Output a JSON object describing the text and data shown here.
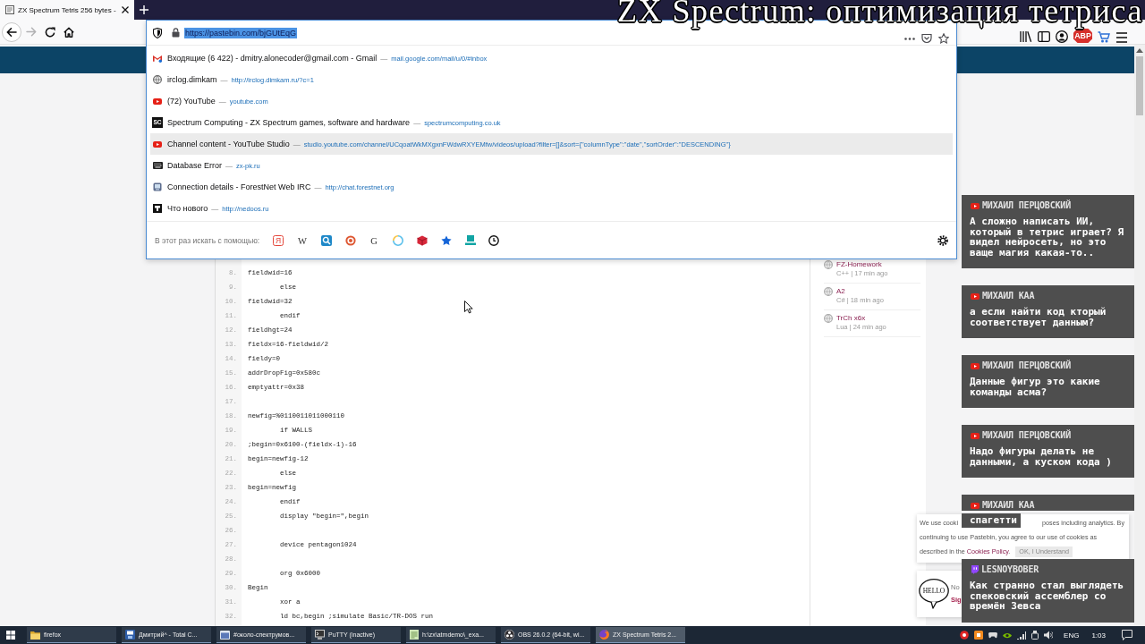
{
  "overlay_title": "ZX Spectrum: оптимизация тетриса",
  "browser": {
    "tabs": [
      {
        "title": "ZX Spectrum Tetris 256 bytes -",
        "selected": true
      }
    ],
    "nav_buttons": [
      {
        "kind": "back",
        "disabled": false
      },
      {
        "kind": "forward",
        "disabled": true
      },
      {
        "kind": "reload",
        "disabled": false
      },
      {
        "kind": "home",
        "disabled": false
      }
    ],
    "address_bar": {
      "value": "https://pastebin.com/bjGUtEqG",
      "selected": true
    },
    "suggestions": [
      {
        "kind": "mail",
        "title": "Входящие (6 422) - dmitry.alonecoder@gmail.com - Gmail",
        "separator": "—",
        "url": "mail.google.com/mail/u/0/#inbox",
        "selected": false
      },
      {
        "kind": "globe",
        "title": "irclog.dimkam",
        "separator": "—",
        "url": "http://irclog.dimkam.ru/?c=1",
        "selected": false
      },
      {
        "kind": "video",
        "title": "(72) YouTube",
        "separator": "—",
        "url": "youtube.com",
        "selected": false
      },
      {
        "kind": "letters",
        "icon_text": "SC",
        "title": "Spectrum Computing - ZX Spectrum games, software and hardware",
        "separator": "—",
        "url": "spectrumcomputing.co.uk",
        "selected": false
      },
      {
        "kind": "video",
        "title": "Channel content - YouTube Studio",
        "separator": "—",
        "url": "studio.youtube.com/channel/UCqoatWkMXgxnFWdwRXYEMfw/videos/upload?filter=[]&sort={\"columnType\":\"date\",\"sortOrder\":\"DESCENDING\"}",
        "selected": true
      },
      {
        "kind": "keyboard",
        "title": "Database Error",
        "separator": "—",
        "url": "zx-pk.ru",
        "selected": false
      },
      {
        "kind": "monitor",
        "title": "Connection details - ForestNet Web IRC",
        "separator": "—",
        "url": "http://chat.forestnet.org",
        "selected": false
      },
      {
        "kind": "tile",
        "title": "Что нового",
        "separator": "—",
        "url": "http://nedoos.ru",
        "selected": false
      }
    ],
    "search_with": {
      "label": "В этот раз искать с помощью:",
      "engines": [
        {
          "kind": "letter_tile",
          "glyph": "Я"
        },
        {
          "kind": "letter",
          "glyph": "W"
        },
        {
          "kind": "search"
        },
        {
          "kind": "round_badge"
        },
        {
          "kind": "letter",
          "glyph": "G"
        },
        {
          "kind": "ring"
        },
        {
          "kind": "cube"
        },
        {
          "kind": "star"
        },
        {
          "kind": "laptop"
        },
        {
          "kind": "clock"
        }
      ]
    },
    "toolbar": {
      "badge_text": "ABP"
    }
  },
  "page": {
    "code_lines": [
      {
        "number": "8.",
        "text": "fieldwid=16"
      },
      {
        "number": "9.",
        "text": "\telse"
      },
      {
        "number": "10.",
        "text": "fieldwid=32"
      },
      {
        "number": "11.",
        "text": "\tendif"
      },
      {
        "number": "12.",
        "text": "fieldhgt=24"
      },
      {
        "number": "13.",
        "text": "fieldx=16-fieldwid/2"
      },
      {
        "number": "14.",
        "text": "fieldy=0"
      },
      {
        "number": "15.",
        "text": "addrDropFig=0x580c"
      },
      {
        "number": "16.",
        "text": "emptyattr=0x38"
      },
      {
        "number": "17."
      },
      {
        "number": "18.",
        "text": "newfig=%0110011011000110"
      },
      {
        "number": "19.",
        "text": "\tif WALLS"
      },
      {
        "number": "20.",
        "text": ";begin=0x6100-(fieldx-1)-16"
      },
      {
        "number": "21.",
        "text": "begin=newfig-12"
      },
      {
        "number": "22.",
        "text": "\telse"
      },
      {
        "number": "23.",
        "text": "begin=newfig"
      },
      {
        "number": "24.",
        "text": "\tendif"
      },
      {
        "number": "25.",
        "text": "\tdisplay \"begin=\",begin"
      },
      {
        "number": "26."
      },
      {
        "number": "27.",
        "text": "\tdevice pentagon1024"
      },
      {
        "number": "28."
      },
      {
        "number": "29.",
        "text": "\torg 0x6000"
      },
      {
        "number": "30.",
        "text": "Begin"
      },
      {
        "number": "31.",
        "text": "\txor a"
      },
      {
        "number": "32.",
        "text": "\tld bc,begin ;simulate Basic/TR-DOS run"
      }
    ],
    "recent_pastes": [
      {
        "title": "FZ-Homework",
        "meta": "C++ | 17 min ago"
      },
      {
        "title": "A2",
        "meta": "C# | 18 min ago"
      },
      {
        "title": "TrCh x6x",
        "meta": "Lua | 24 min ago"
      }
    ],
    "cookie_notice": {
      "fragment_1": "We use cooki",
      "fragment_2": "poses including analytics. By",
      "line_2": "continuing to use Pastebin, you agree to our use of cookies as",
      "line_3_text": "described in the",
      "policy_link": "Cookies Policy",
      "line_3_end": ".",
      "accept_button": "OK, I Understand"
    },
    "signup": {
      "badge": "HELLO",
      "fragment_1": "No",
      "fragment_2": "Sig"
    }
  },
  "chat": [
    {
      "kind": "youtube",
      "author": "МИХАИЛ ПЕРЦОВСКИЙ",
      "text": "А сложно написать ИИ, который в тетрис играет? Я видел нейросеть, но это ваще магия какая-то.."
    },
    {
      "kind": "youtube",
      "author": "МИХАИЛ КАА",
      "text": "а если найти код кторый соответствует данным?"
    },
    {
      "kind": "youtube",
      "author": "МИХАИЛ ПЕРЦОВСКИЙ",
      "text": "Данные фигур это какие команды асма?"
    },
    {
      "kind": "youtube",
      "author": "МИХАИЛ ПЕРЦОВСКИЙ",
      "text": "Надо фигуры делать не данными, а куском кода )"
    },
    {
      "kind": "youtube",
      "author": "МИХАИЛ КАА",
      "text": "спагетти"
    },
    {
      "kind": "twitch",
      "author": "LESNOYBOBER",
      "text": "Как странно стал выглядеть спековский ассемблер со времён Зевса"
    }
  ],
  "taskbar": {
    "items": [
      {
        "kind": "folder",
        "label": "firefox",
        "selected": false
      },
      {
        "kind": "commander",
        "label": "Дмитрий^ - Total C...",
        "selected": false
      },
      {
        "kind": "chat",
        "label": "#около-спектрумов...",
        "selected": false
      },
      {
        "kind": "terminal",
        "label": "PuTTY (inactive)",
        "selected": false
      },
      {
        "kind": "notepad",
        "label": "h:\\zx\\atmdemo\\_exa...",
        "selected": false
      },
      {
        "kind": "recorder",
        "label": "OBS 26.0.2 (64-bit, wi...",
        "selected": false
      },
      {
        "kind": "browser",
        "label": "ZX Spectrum Tetris 2...",
        "selected": true
      }
    ],
    "language": "ENG",
    "time": "1:03"
  }
}
